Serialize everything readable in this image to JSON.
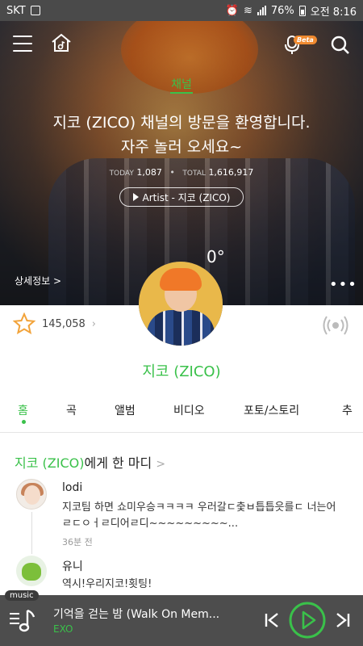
{
  "status_bar": {
    "carrier": "SKT",
    "battery": "76%",
    "time": "오전 8:16"
  },
  "hero": {
    "channel_tab": "채널",
    "welcome_line1": "지코 (ZICO) 채널의 방문을 환영합니다.",
    "welcome_line2": "자주 놀러 오세요~",
    "today_label": "TODAY",
    "today_value": "1,087",
    "total_label": "TOTAL",
    "total_value": "1,616,917",
    "artist_link": "Artist - 지코 (ZICO)",
    "angle": "0°",
    "detail_link": "상세정보 >",
    "beta_badge": "Beta"
  },
  "fan": {
    "count": "145,058"
  },
  "artist_name": "지코 (ZICO)",
  "tabs": [
    "홈",
    "곡",
    "앨범",
    "비디오",
    "포토/스토리",
    "추"
  ],
  "section": {
    "title_green": "지코 (ZICO)",
    "title_rest": "에게 한 마디",
    "chevron": ">"
  },
  "comments": [
    {
      "name": "lodi",
      "text": "지코팀 하면 쇼미우승ㅋㅋㅋㅋ 우러갈ㄷ춫ㅂ틉틉읏를ㄷ 너는어ㄹㄷㅇㅓㄹ디어ㄹ디~~~~~~~~~...",
      "time": "36분 전"
    },
    {
      "name": "유니",
      "text": "역시!우리지코!횟팅!"
    }
  ],
  "player": {
    "tag": "music",
    "song": "기억을 걷는 밤 (Walk On Mem...",
    "artist": "EXO"
  },
  "colors": {
    "accent": "#3ac14a",
    "player_bg": "#4d4d4d"
  }
}
